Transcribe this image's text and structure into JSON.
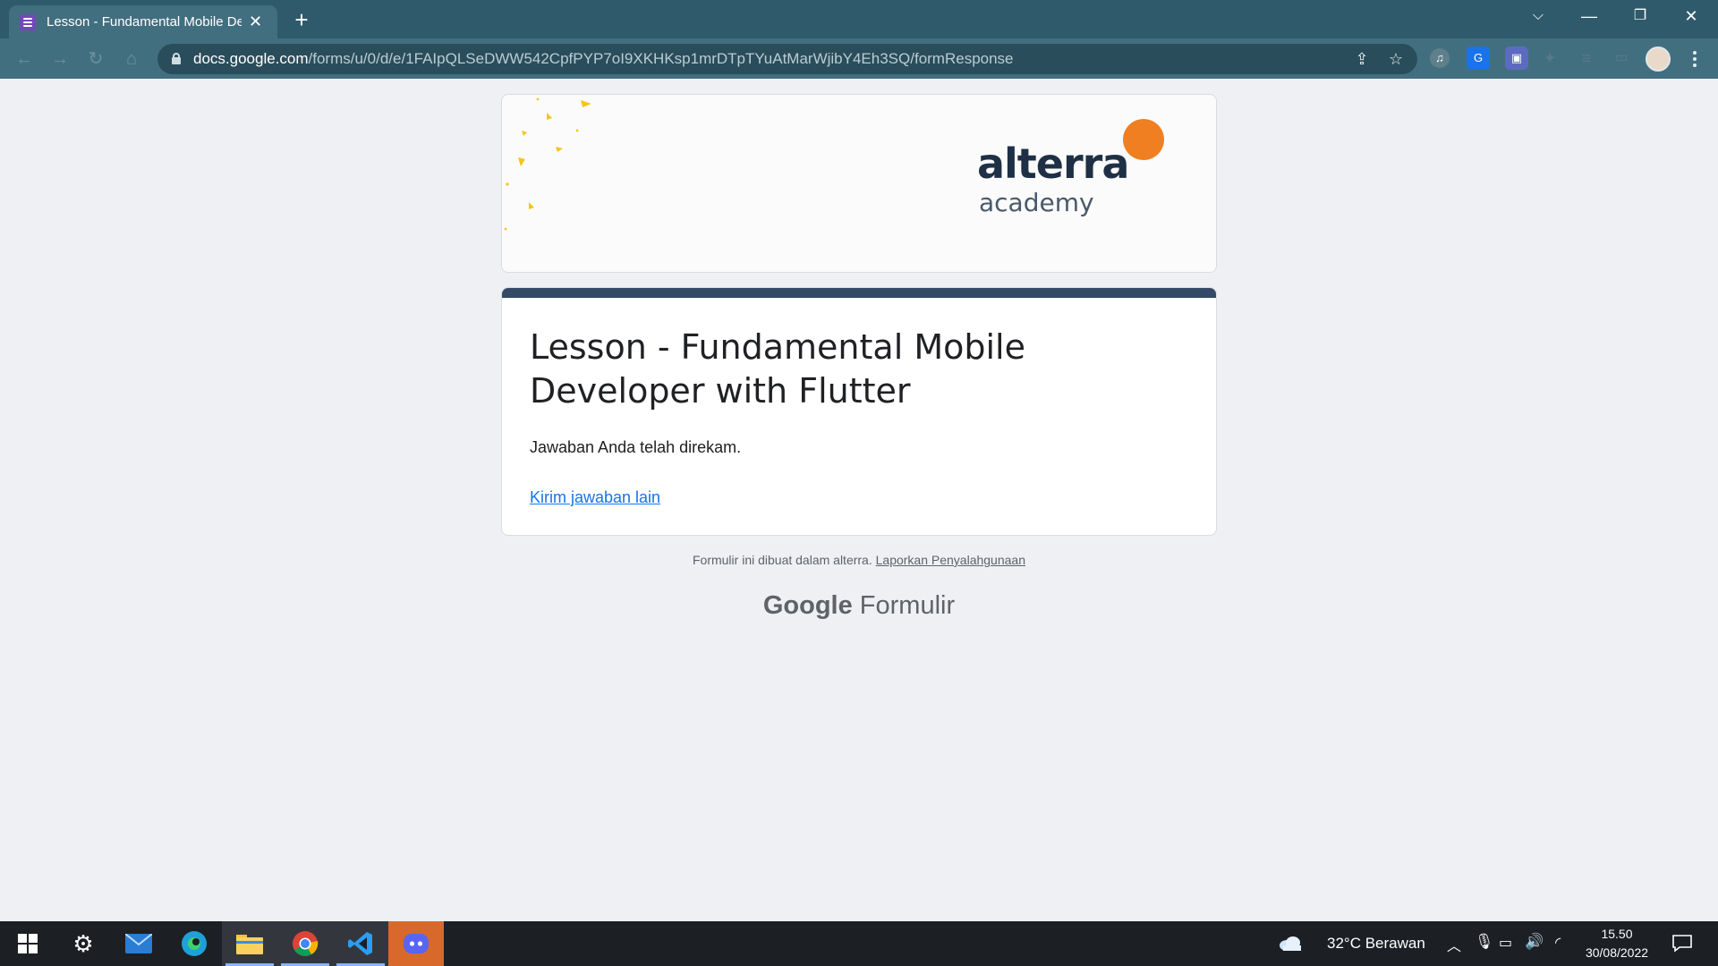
{
  "browser": {
    "tab_title": "Lesson - Fundamental Mobile De",
    "url_host": "docs.google.com",
    "url_path": "/forms/u/0/d/e/1FAIpQLSeDWW542CpfPYP7oI9XKHKsp1mrDTpTYuAtMarWjibY4Eh3SQ/formResponse"
  },
  "banner": {
    "logo_word": "alterra",
    "logo_sub": "academy"
  },
  "form": {
    "title": "Lesson - Fundamental Mobile Developer with Flutter",
    "confirmation": "Jawaban Anda telah direkam.",
    "another_response_link": "Kirim jawaban lain"
  },
  "footer": {
    "created_text": "Formulir ini dibuat dalam alterra.",
    "report_link": "Laporkan Penyalahgunaan",
    "brand_google": "Google",
    "brand_product": "Formulir"
  },
  "taskbar": {
    "weather": "32°C  Berawan",
    "time": "15.50",
    "date": "30/08/2022"
  },
  "colors": {
    "accent": "#344a67",
    "logo_orange": "#f07f21",
    "link": "#1a73e8"
  }
}
